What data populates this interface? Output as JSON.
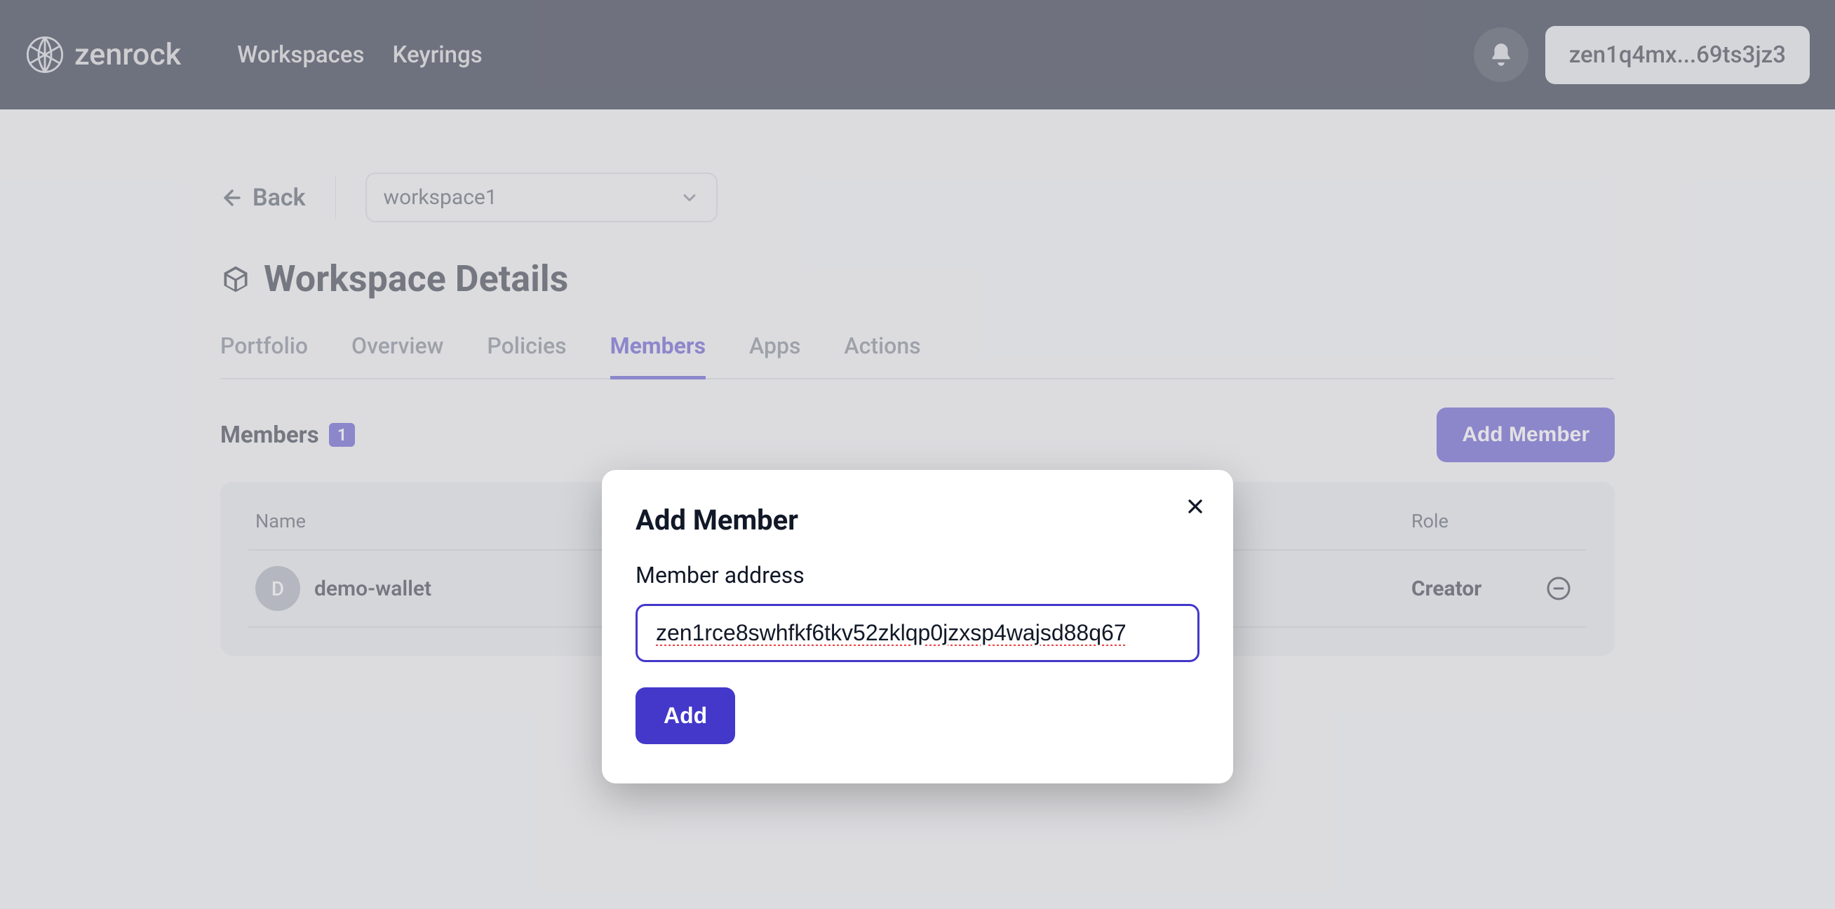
{
  "header": {
    "brand": "zenrock",
    "nav": {
      "workspaces": "Workspaces",
      "keyrings": "Keyrings"
    },
    "wallet": "zen1q4mx...69ts3jz3"
  },
  "page": {
    "back": "Back",
    "workspace_selected": "workspace1",
    "title": "Workspace Details",
    "tabs": {
      "portfolio": "Portfolio",
      "overview": "Overview",
      "policies": "Policies",
      "members": "Members",
      "apps": "Apps",
      "actions": "Actions"
    }
  },
  "members": {
    "label": "Members",
    "count": "1",
    "add_btn": "Add Member",
    "columns": {
      "name": "Name",
      "role": "Role"
    },
    "rows": [
      {
        "initial": "D",
        "name": "demo-wallet",
        "role": "Creator"
      }
    ]
  },
  "modal": {
    "title": "Add Member",
    "field_label": "Member address",
    "address_value": "zen1rce8swhfkf6tkv52zklqp0jzxsp4wajsd88q67",
    "add_btn": "Add"
  }
}
